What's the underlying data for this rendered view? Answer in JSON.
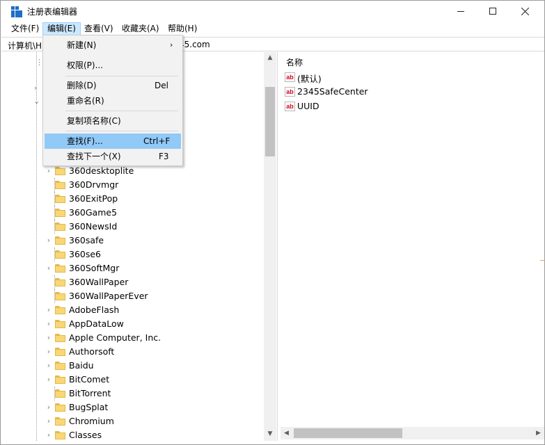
{
  "window": {
    "title": "注册表编辑器"
  },
  "menubar": {
    "items": [
      "文件(F)",
      "编辑(E)",
      "查看(V)",
      "收藏夹(A)",
      "帮助(H)"
    ],
    "active_index": 1
  },
  "address": {
    "prefix": "计算机\\H",
    "suffix": "45.com"
  },
  "edit_menu": {
    "items": [
      {
        "label": "新建(N)",
        "shortcut": "",
        "submenu": true
      },
      {
        "label": "权限(P)...",
        "shortcut": "",
        "submenu": false
      },
      {
        "label": "删除(D)",
        "shortcut": "Del",
        "submenu": false
      },
      {
        "label": "重命名(R)",
        "shortcut": "",
        "submenu": false
      },
      {
        "label": "复制项名称(C)",
        "shortcut": "",
        "submenu": false
      },
      {
        "label": "查找(F)...",
        "shortcut": "Ctrl+F",
        "submenu": false
      },
      {
        "label": "查找下一个(X)",
        "shortcut": "F3",
        "submenu": false
      }
    ],
    "highlighted_index": 5
  },
  "tree": {
    "keys": [
      {
        "label": "360desktoplite",
        "expandable": true
      },
      {
        "label": "360Drvmgr",
        "expandable": false
      },
      {
        "label": "360ExitPop",
        "expandable": false
      },
      {
        "label": "360Game5",
        "expandable": false
      },
      {
        "label": "360NewsId",
        "expandable": false
      },
      {
        "label": "360safe",
        "expandable": true
      },
      {
        "label": "360se6",
        "expandable": false
      },
      {
        "label": "360SoftMgr",
        "expandable": true
      },
      {
        "label": "360WallPaper",
        "expandable": false
      },
      {
        "label": "360WallPaperEver",
        "expandable": false
      },
      {
        "label": "AdobeFlash",
        "expandable": true
      },
      {
        "label": "AppDataLow",
        "expandable": true
      },
      {
        "label": "Apple Computer, Inc.",
        "expandable": true
      },
      {
        "label": "Authorsoft",
        "expandable": true
      },
      {
        "label": "Baidu",
        "expandable": true
      },
      {
        "label": "BitComet",
        "expandable": true
      },
      {
        "label": "BitTorrent",
        "expandable": false
      },
      {
        "label": "BugSplat",
        "expandable": true
      },
      {
        "label": "Chromium",
        "expandable": true
      },
      {
        "label": "Classes",
        "expandable": true
      }
    ]
  },
  "values": {
    "column_name": "名称",
    "rows": [
      "(默认)",
      "2345SafeCenter",
      "UUID"
    ]
  },
  "icons": {
    "string_value_icon": "ab-icon",
    "folder_icon": "folder-icon"
  }
}
